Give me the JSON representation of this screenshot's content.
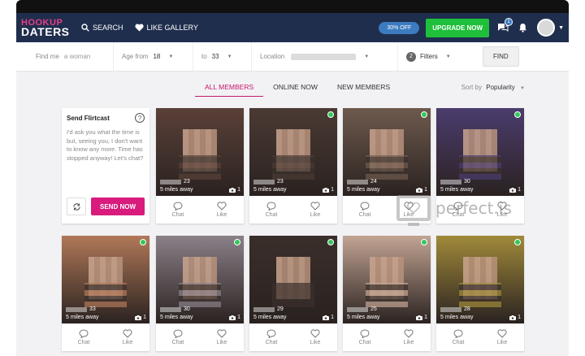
{
  "header": {
    "logo_line1": "HOOKUP",
    "logo_line2": "DATERS",
    "search_label": "SEARCH",
    "gallery_label": "LIKE GALLERY",
    "discount_label": "30% OFF",
    "upgrade_label": "UPGRADE NOW",
    "messages_badge": "1"
  },
  "filters": {
    "find_me_label": "Find me",
    "find_me_value": "a woman",
    "age_from_label": "Age from",
    "age_from_value": "18",
    "age_to_label": "to",
    "age_to_value": "33",
    "location_label": "Location",
    "filters_count": "2",
    "filters_label": "Filters",
    "find_button": "FIND"
  },
  "tabs": {
    "all_members": "ALL MEMBERS",
    "online_now": "ONLINE NOW",
    "new_members": "NEW MEMBERS"
  },
  "sort": {
    "label": "Sort by",
    "value": "Popularity"
  },
  "flirtcast": {
    "title": "Send Flirtcast",
    "message": "I'd ask you what the time is but, seeing you, I don't want to know any more. Time has stopped anyway! Let's chat?",
    "send_button": "SEND NOW"
  },
  "card_labels": {
    "chat": "Chat",
    "like": "Like"
  },
  "members": [
    {
      "age": "23",
      "distance": "5 miles away",
      "photos": "1",
      "online": false,
      "color": "#5a4038"
    },
    {
      "age": "23",
      "distance": "5 miles away",
      "photos": "1",
      "online": true,
      "color": "#4a3a33"
    },
    {
      "age": "24",
      "distance": "5 miles away",
      "photos": "1",
      "online": true,
      "color": "#6e5a4e"
    },
    {
      "age": "30",
      "distance": "5 miles away",
      "photos": "1",
      "online": true,
      "color": "#4b3c6e"
    },
    {
      "age": "33",
      "distance": "5 miles away",
      "photos": "1",
      "online": true,
      "color": "#b07858"
    },
    {
      "age": "30",
      "distance": "5 miles away",
      "photos": "1",
      "online": true,
      "color": "#8a8088"
    },
    {
      "age": "29",
      "distance": "5 miles away",
      "photos": "1",
      "online": true,
      "color": "#3a2e2a"
    },
    {
      "age": "25",
      "distance": "5 miles away",
      "photos": "1",
      "online": true,
      "color": "#c2a493"
    },
    {
      "age": "28",
      "distance": "5 miles away",
      "photos": "1",
      "online": true,
      "color": "#a08a3a"
    }
  ],
  "watermark": "perfect.is"
}
